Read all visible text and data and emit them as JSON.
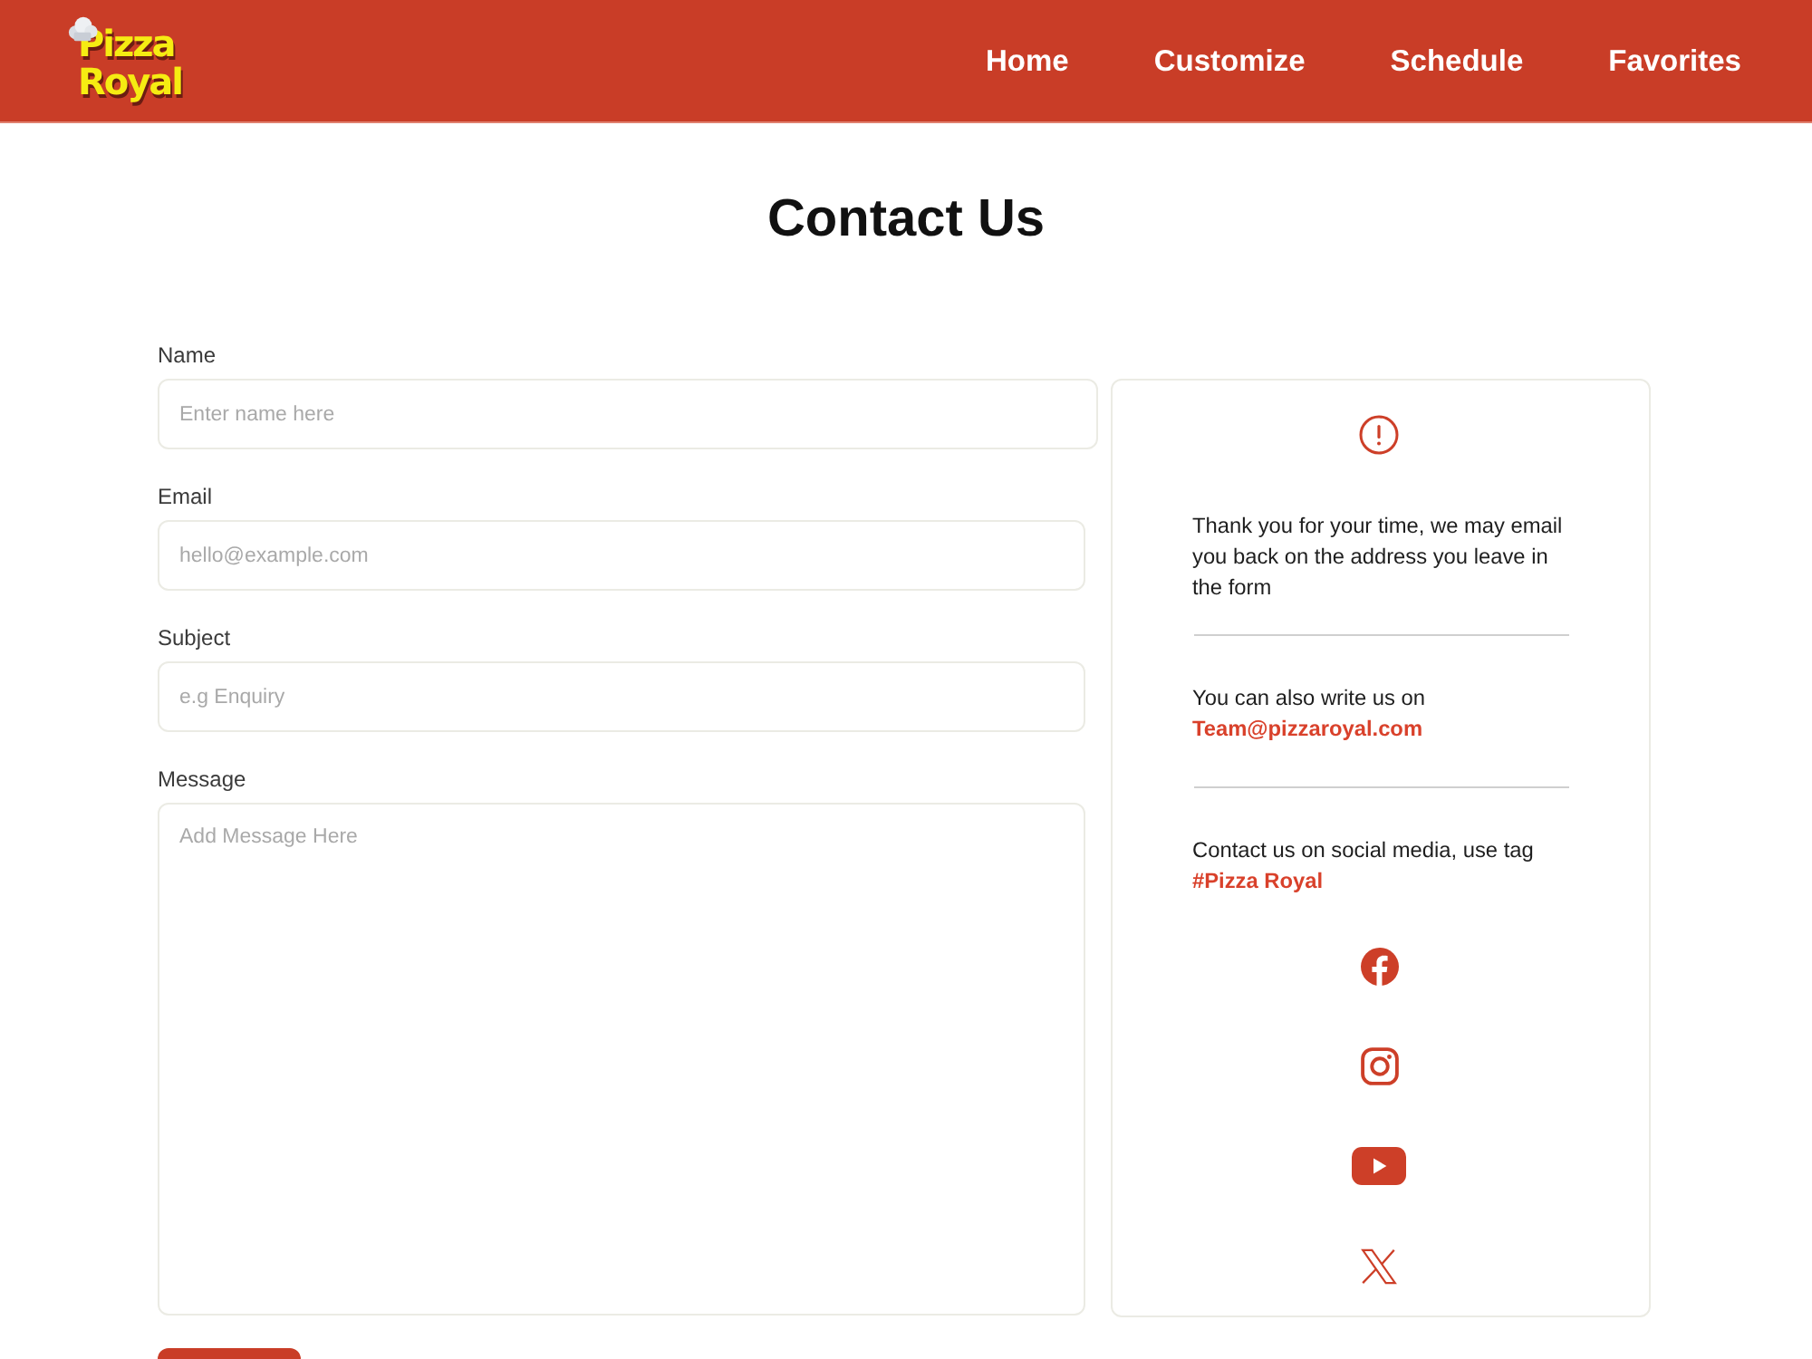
{
  "header": {
    "logo_text": "Pizza Royal",
    "nav": [
      {
        "label": "Home"
      },
      {
        "label": "Customize"
      },
      {
        "label": "Schedule"
      },
      {
        "label": "Favorites"
      }
    ]
  },
  "page_title": "Contact Us",
  "form": {
    "fields": [
      {
        "kind": "input",
        "label": "Name",
        "placeholder": "Enter name here"
      },
      {
        "kind": "input",
        "label": "Email",
        "placeholder": "hello@example.com"
      },
      {
        "kind": "input",
        "label": "Subject",
        "placeholder": "e.g Enquiry"
      },
      {
        "kind": "textarea",
        "label": "Message",
        "placeholder": "Add Message Here"
      }
    ]
  },
  "info_card": {
    "note": "Thank you for your time, we may email you back on the address you leave in the form",
    "email_text": "You can also write us on",
    "email": "Team@pizzaroyal.com",
    "social_text": "Contact us on social media, use tag",
    "hashtag": "#Pizza Royal"
  }
}
